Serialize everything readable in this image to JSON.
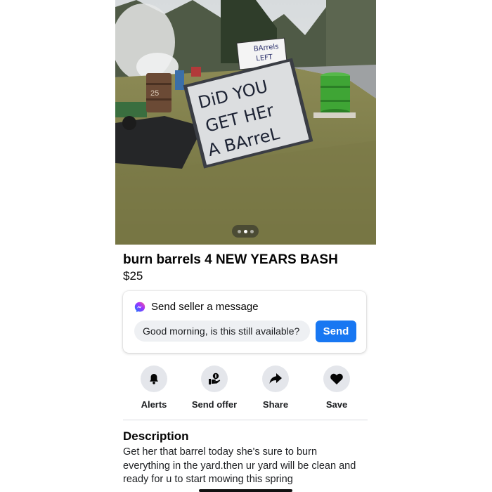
{
  "listing": {
    "photo": {
      "sign_text_lines": [
        "DiD YOU",
        "GET HEr",
        "A BArreL"
      ],
      "small_sign_text": [
        "BArrels",
        "LEFT"
      ],
      "barrel_text": "25",
      "page_count": 3,
      "active_page": 2
    },
    "title": "burn barrels 4 NEW YEARS BASH",
    "price": "$25"
  },
  "message_card": {
    "heading": "Send seller a message",
    "input_value": "Good morning, is this still available?",
    "send_label": "Send"
  },
  "actions": [
    {
      "label": "Alerts",
      "icon": "bell-icon"
    },
    {
      "label": "Send offer",
      "icon": "offer-icon"
    },
    {
      "label": "Share",
      "icon": "share-arrow-icon"
    },
    {
      "label": "Save",
      "icon": "heart-icon"
    }
  ],
  "description": {
    "heading": "Description",
    "lines": [
      "Get her that barrel today she's sure to burn",
      "everything in the yard.then ur yard will be clean and",
      "ready for u to start mowing this spring"
    ]
  },
  "colors": {
    "accent": "#1877f2",
    "icon_bg": "#e4e6eb",
    "barrel_green": "#3fa535",
    "smoke": "#dfe1e3"
  }
}
